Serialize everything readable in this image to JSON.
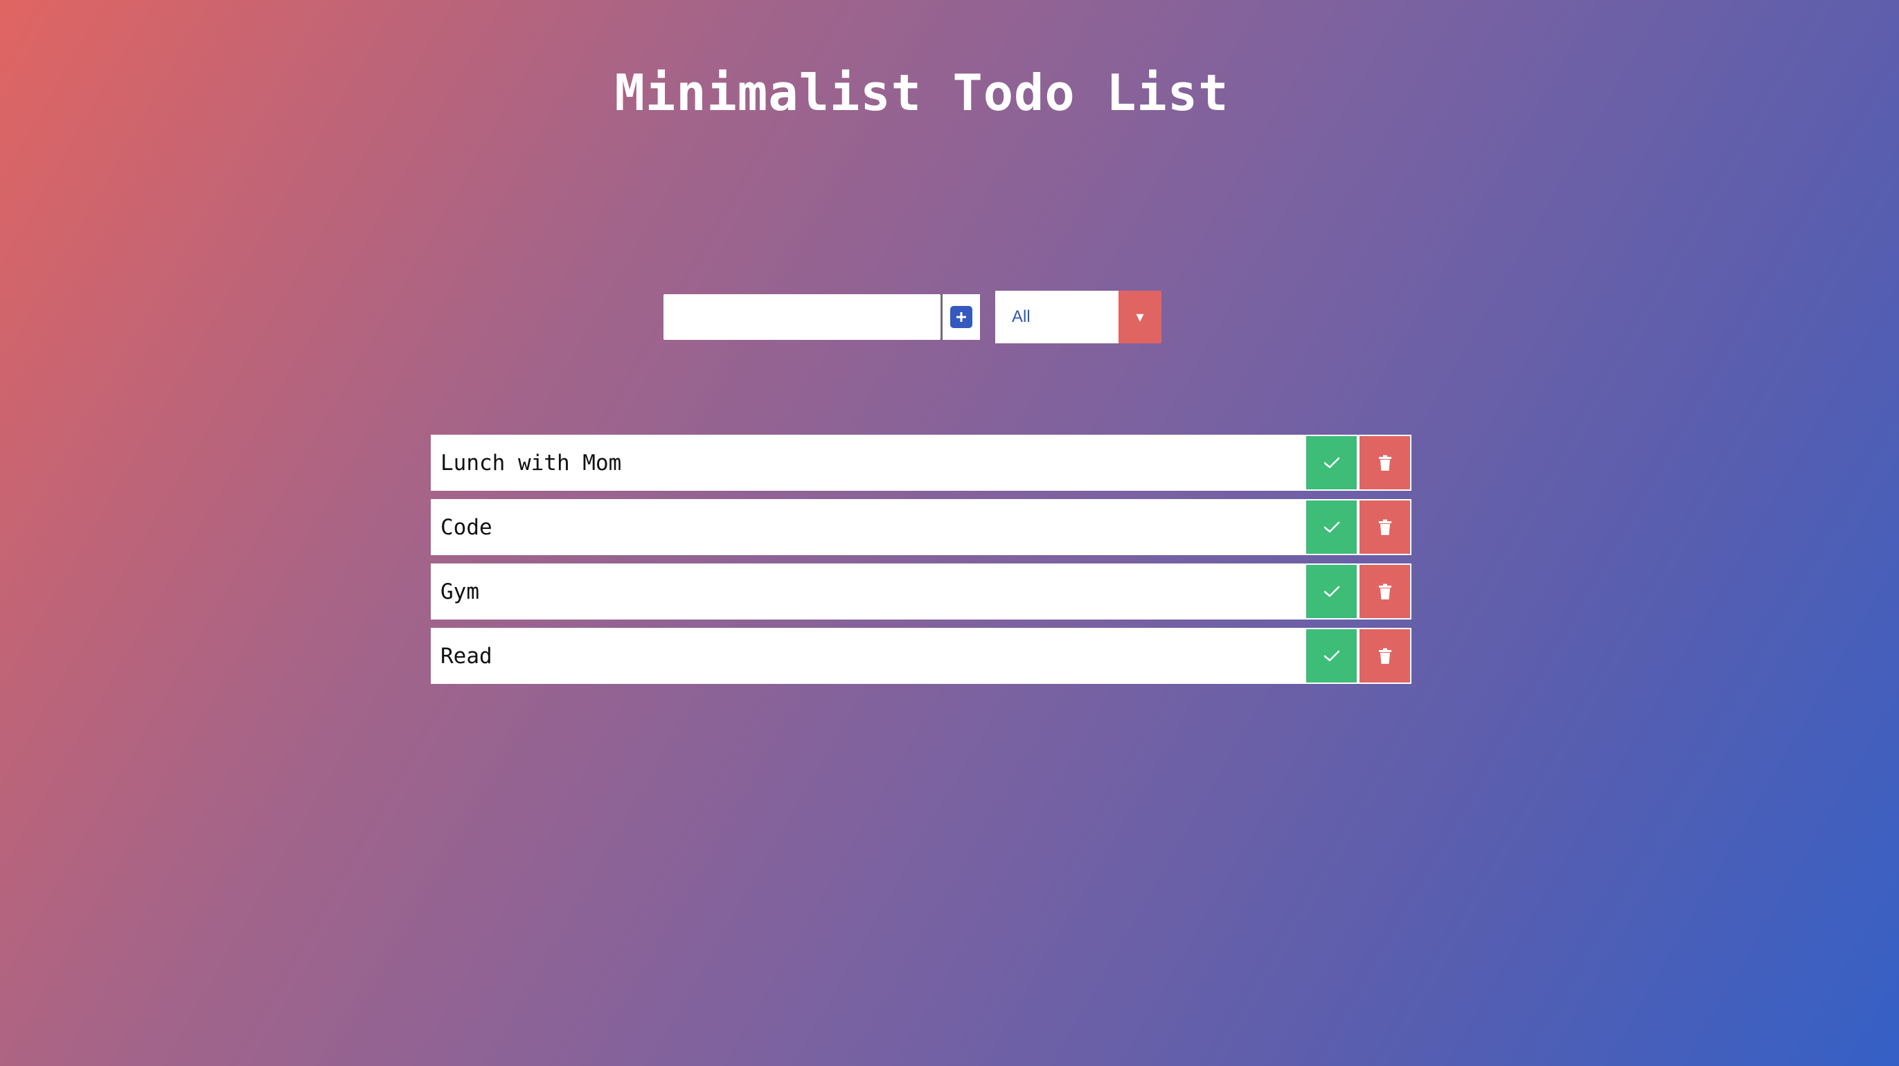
{
  "page": {
    "title": "Minimalist Todo List"
  },
  "form": {
    "input_value": "",
    "input_placeholder": "",
    "add_icon": "plus-icon"
  },
  "filter": {
    "selected": "All",
    "arrow_glyph": "▾"
  },
  "todos": [
    {
      "text": "Lunch with Mom",
      "complete_icon": "check-icon",
      "delete_icon": "trash-icon"
    },
    {
      "text": "Code",
      "complete_icon": "check-icon",
      "delete_icon": "trash-icon"
    },
    {
      "text": "Gym",
      "complete_icon": "check-icon",
      "delete_icon": "trash-icon"
    },
    {
      "text": "Read",
      "complete_icon": "check-icon",
      "delete_icon": "trash-icon"
    }
  ],
  "colors": {
    "gradient_start": "#e06562",
    "gradient_end": "#3560c6",
    "accent_blue": "#3559be",
    "complete_green": "#3dbd78",
    "delete_red": "#e06562",
    "text_white": "#ffffff"
  }
}
